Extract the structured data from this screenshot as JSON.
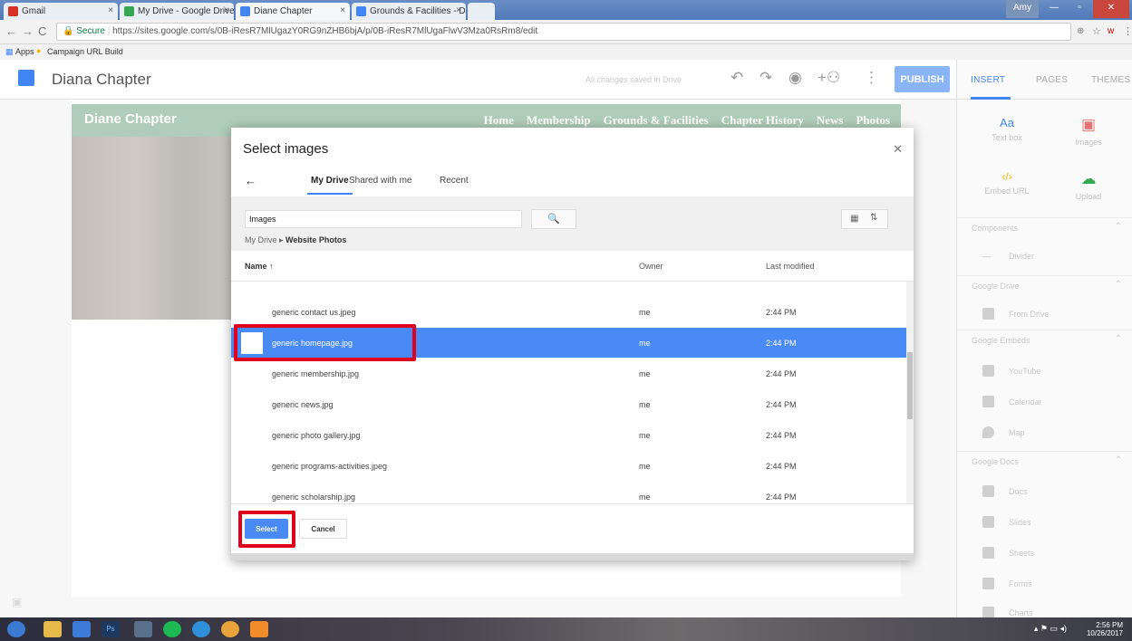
{
  "browser": {
    "tabs": [
      {
        "label": "Gmail",
        "fav_color": "#d93025"
      },
      {
        "label": "My Drive - Google Drive",
        "fav_color": "#34a853"
      },
      {
        "label": "Diane Chapter",
        "fav_color": "#4285f4"
      },
      {
        "label": "Grounds & Facilities - Do",
        "fav_color": "#4285f4"
      }
    ],
    "user": "Amy",
    "secure_label": "Secure",
    "url": "https://sites.google.com/s/0B-iResR7MlUgazY0RG9nZHB6bjA/p/0B-iResR7MlUgaFlwV3Mza0RsRm8/edit",
    "bookmarks": [
      "Apps",
      "Campaign URL Build"
    ]
  },
  "sites_header": {
    "site_name": "Diana Chapter",
    "save_status": "All changes saved in Drive",
    "publish_label": "PUBLISH"
  },
  "site_preview": {
    "title": "Diane Chapter",
    "nav_links": [
      "Home",
      "Membership",
      "Grounds & Facilities",
      "Chapter History",
      "News",
      "Photos"
    ]
  },
  "right_panel": {
    "tabs": [
      "INSERT",
      "PAGES",
      "THEMES"
    ],
    "tiles": [
      {
        "label": "Text box",
        "icon": "Aa"
      },
      {
        "label": "Images",
        "icon": "▣"
      },
      {
        "label": "Embed URL",
        "icon": "‹/›"
      },
      {
        "label": "Upload",
        "icon": "☁"
      }
    ],
    "sections": [
      {
        "title": "Components",
        "items": [
          "Divider"
        ]
      },
      {
        "title": "Google Drive",
        "items": [
          "From Drive"
        ]
      },
      {
        "title": "Google Embeds",
        "items": [
          "YouTube",
          "Calendar",
          "Map"
        ]
      },
      {
        "title": "Google Docs",
        "items": [
          "Docs",
          "Slides",
          "Sheets",
          "Forms",
          "Charts"
        ]
      }
    ]
  },
  "modal": {
    "title": "Select images",
    "tabs": [
      "My Drive",
      "Shared with me",
      "Recent"
    ],
    "search_value": "Images",
    "breadcrumb_root": "My Drive",
    "breadcrumb_folder": "Website Photos",
    "columns": {
      "name": "Name",
      "owner": "Owner",
      "modified": "Last modified"
    },
    "files": [
      {
        "name": "generic contact us.jpeg",
        "owner": "me",
        "modified": "2:44 PM"
      },
      {
        "name": "generic homepage.jpg",
        "owner": "me",
        "modified": "2:44 PM",
        "selected": true
      },
      {
        "name": "generic membership.jpg",
        "owner": "me",
        "modified": "2:44 PM"
      },
      {
        "name": "generic news.jpg",
        "owner": "me",
        "modified": "2:44 PM"
      },
      {
        "name": "generic photo gallery.jpg",
        "owner": "me",
        "modified": "2:44 PM"
      },
      {
        "name": "generic programs-activities.jpeg",
        "owner": "me",
        "modified": "2:44 PM"
      },
      {
        "name": "generic scholarship.jpg",
        "owner": "me",
        "modified": "2:44 PM"
      }
    ],
    "select_label": "Select",
    "cancel_label": "Cancel"
  },
  "taskbar": {
    "time": "2:56 PM",
    "date": "10/26/2017"
  },
  "colors": {
    "accent": "#4285f4",
    "selection": "#4a8af4",
    "site_header": "#6ea57e",
    "highlight": "#e0001b"
  }
}
